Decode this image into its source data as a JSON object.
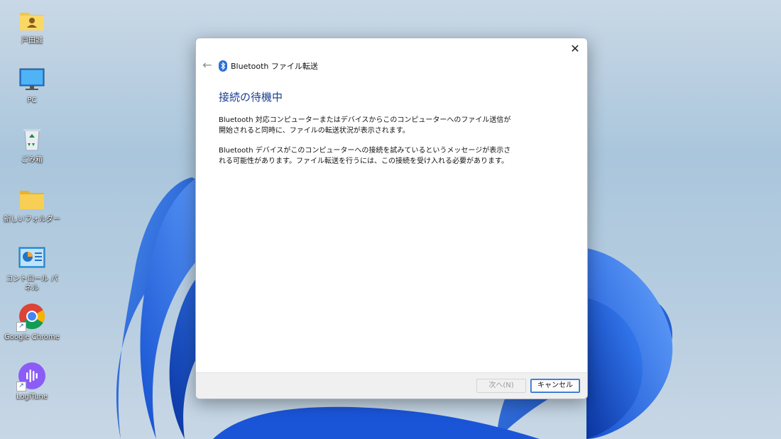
{
  "desktop": {
    "icons": [
      {
        "label": "戸田誠"
      },
      {
        "label": "PC"
      },
      {
        "label": "ごみ箱"
      },
      {
        "label": "新しいフォルダー"
      },
      {
        "label": "コントロール パネル"
      },
      {
        "label": "Google Chrome"
      },
      {
        "label": "LogiTune"
      }
    ]
  },
  "dialog": {
    "title": "Bluetooth ファイル転送",
    "back_icon": "back-arrow-icon",
    "close_icon": "close-icon",
    "heading": "接続の待機中",
    "paragraph1": "Bluetooth 対応コンピューターまたはデバイスからこのコンピューターへのファイル送信が開始されると同時に、ファイルの転送状況が表示されます。",
    "paragraph2": "Bluetooth デバイスがこのコンピューターへの接続を試みているというメッセージが表示される可能性があります。ファイル転送を行うには、この接続を受け入れる必要があります。",
    "buttons": {
      "next": "次へ(N)",
      "cancel": "キャンセル"
    }
  },
  "colors": {
    "heading": "#1a3d8f",
    "accent": "#2c6fd0",
    "bloom": "#1e63e0"
  }
}
